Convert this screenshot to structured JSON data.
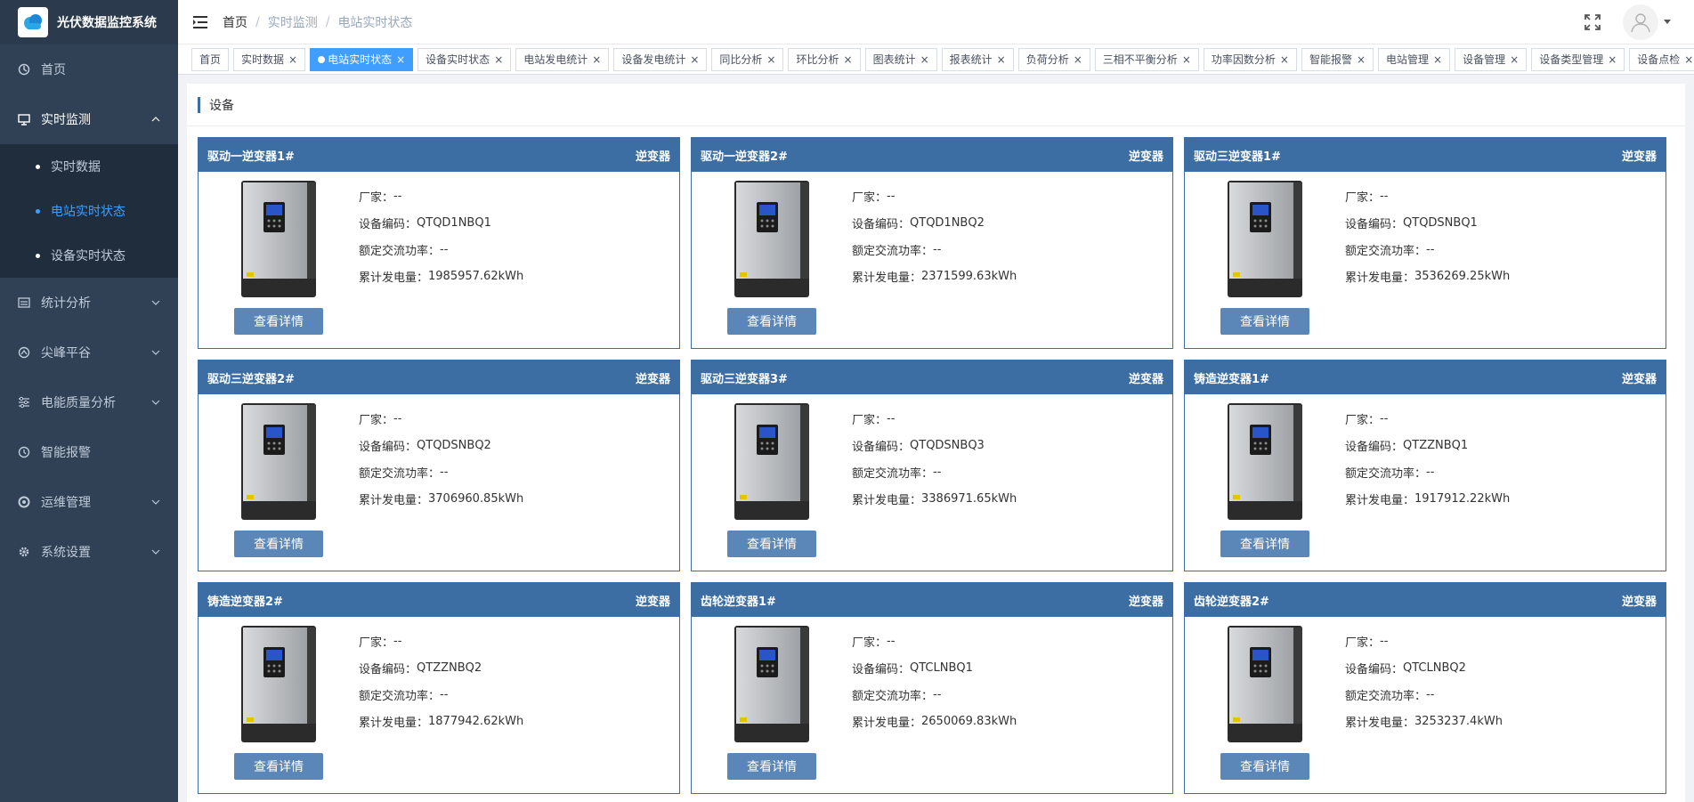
{
  "app": {
    "title": "光伏数据监控系统"
  },
  "colors": {
    "sidebar": "#304156",
    "accent": "#409eff",
    "card_header": "#3c6ea4",
    "button": "#5a86b8"
  },
  "sidebar": {
    "items": [
      {
        "label": "首页",
        "icon": "home-icon"
      },
      {
        "label": "实时监测",
        "icon": "monitor-icon",
        "open": true,
        "children": [
          {
            "label": "实时数据"
          },
          {
            "label": "电站实时状态",
            "active": true
          },
          {
            "label": "设备实时状态"
          }
        ]
      },
      {
        "label": "统计分析",
        "icon": "chart-icon"
      },
      {
        "label": "尖峰平谷",
        "icon": "peak-icon"
      },
      {
        "label": "电能质量分析",
        "icon": "sliders-icon"
      },
      {
        "label": "智能报警",
        "icon": "alarm-icon"
      },
      {
        "label": "运维管理",
        "icon": "ops-icon"
      },
      {
        "label": "系统设置",
        "icon": "gear-icon"
      }
    ]
  },
  "header": {
    "breadcrumb": [
      "首页",
      "实时监测",
      "电站实时状态"
    ]
  },
  "tags": [
    {
      "label": "首页",
      "closable": false
    },
    {
      "label": "实时数据",
      "closable": true
    },
    {
      "label": "电站实时状态",
      "closable": true,
      "active": true
    },
    {
      "label": "设备实时状态",
      "closable": true
    },
    {
      "label": "电站发电统计",
      "closable": true
    },
    {
      "label": "设备发电统计",
      "closable": true
    },
    {
      "label": "同比分析",
      "closable": true
    },
    {
      "label": "环比分析",
      "closable": true
    },
    {
      "label": "图表统计",
      "closable": true
    },
    {
      "label": "报表统计",
      "closable": true
    },
    {
      "label": "负荷分析",
      "closable": true
    },
    {
      "label": "三相不平衡分析",
      "closable": true
    },
    {
      "label": "功率因数分析",
      "closable": true
    },
    {
      "label": "智能报警",
      "closable": true
    },
    {
      "label": "电站管理",
      "closable": true
    },
    {
      "label": "设备管理",
      "closable": true
    },
    {
      "label": "设备类型管理",
      "closable": true
    },
    {
      "label": "设备点检",
      "closable": true
    }
  ],
  "panel": {
    "title": "设备"
  },
  "labels": {
    "manufacturer": "厂家：",
    "code": "设备编码：",
    "rated_power": "额定交流功率：",
    "total_energy": "累计发电量：",
    "detail_button": "查看详情"
  },
  "devices": [
    {
      "name": "驱动一逆变器1#",
      "type": "逆变器",
      "manufacturer": "--",
      "code": "QTQD1NBQ1",
      "rated_power": "--",
      "total_energy": "1985957.62kWh"
    },
    {
      "name": "驱动一逆变器2#",
      "type": "逆变器",
      "manufacturer": "--",
      "code": "QTQD1NBQ2",
      "rated_power": "--",
      "total_energy": "2371599.63kWh"
    },
    {
      "name": "驱动三逆变器1#",
      "type": "逆变器",
      "manufacturer": "--",
      "code": "QTQDSNBQ1",
      "rated_power": "--",
      "total_energy": "3536269.25kWh"
    },
    {
      "name": "驱动三逆变器2#",
      "type": "逆变器",
      "manufacturer": "--",
      "code": "QTQDSNBQ2",
      "rated_power": "--",
      "total_energy": "3706960.85kWh"
    },
    {
      "name": "驱动三逆变器3#",
      "type": "逆变器",
      "manufacturer": "--",
      "code": "QTQDSNBQ3",
      "rated_power": "--",
      "total_energy": "3386971.65kWh"
    },
    {
      "name": "铸造逆变器1#",
      "type": "逆变器",
      "manufacturer": "--",
      "code": "QTZZNBQ1",
      "rated_power": "--",
      "total_energy": "1917912.22kWh"
    },
    {
      "name": "铸造逆变器2#",
      "type": "逆变器",
      "manufacturer": "--",
      "code": "QTZZNBQ2",
      "rated_power": "--",
      "total_energy": "1877942.62kWh"
    },
    {
      "name": "齿轮逆变器1#",
      "type": "逆变器",
      "manufacturer": "--",
      "code": "QTCLNBQ1",
      "rated_power": "--",
      "total_energy": "2650069.83kWh"
    },
    {
      "name": "齿轮逆变器2#",
      "type": "逆变器",
      "manufacturer": "--",
      "code": "QTCLNBQ2",
      "rated_power": "--",
      "total_energy": "3253237.4kWh"
    }
  ]
}
